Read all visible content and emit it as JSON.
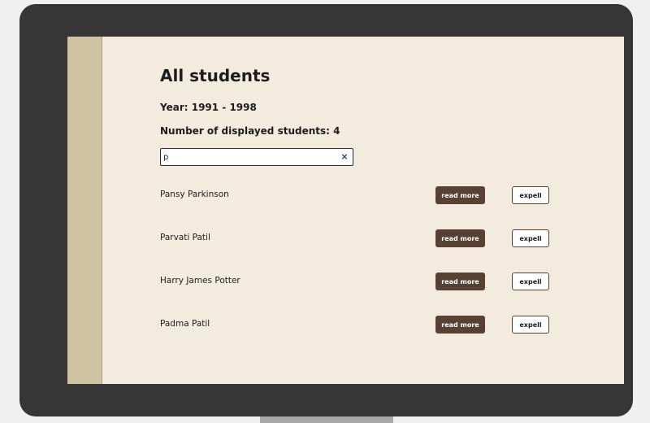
{
  "header": {
    "title": "All students",
    "year": "Year: 1991 - 1998",
    "displayed_count": "Number of displayed students: 4"
  },
  "search": {
    "value": "p",
    "clear_label": "×"
  },
  "students": [
    {
      "name": "Pansy Parkinson",
      "read_more_label": "read more",
      "expell_label": "expell"
    },
    {
      "name": "Parvati Patil",
      "read_more_label": "read more",
      "expell_label": "expell"
    },
    {
      "name": "Harry James Potter",
      "read_more_label": "read more",
      "expell_label": "expell"
    },
    {
      "name": "Padma Patil",
      "read_more_label": "read more",
      "expell_label": "expell"
    }
  ],
  "colors": {
    "bezel": "#363636",
    "screen_bg": "#f2ebde",
    "sidebar": "#cfc3a4",
    "primary_button": "#574134",
    "clear_icon": "#1f3f6e"
  }
}
